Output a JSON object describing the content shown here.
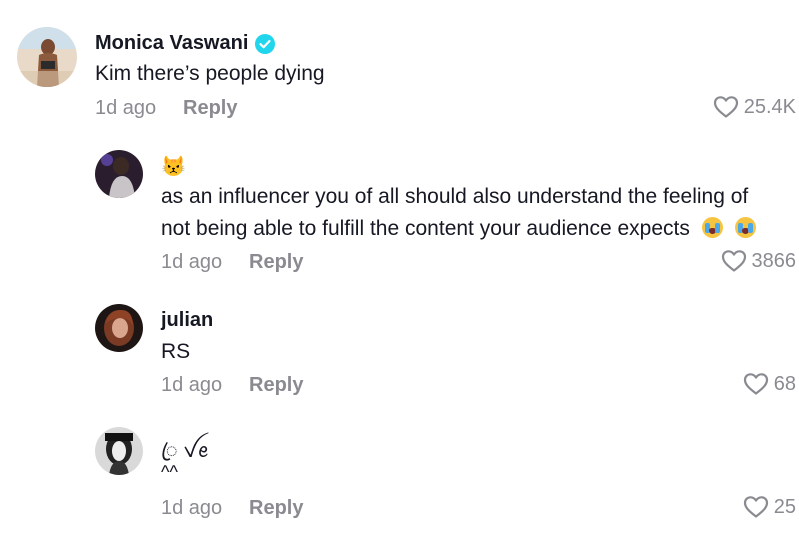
{
  "comments": [
    {
      "username": "Monica Vaswani",
      "verified": true,
      "text": "Kim there’s people dying",
      "time": "1d ago",
      "reply": "Reply",
      "likes": "25.4K"
    },
    {
      "username": "😾",
      "text_line1": "as an influencer you of all should also understand the feeling of",
      "text_line2": "not being able to fulfill the content your audience expects",
      "time": "1d ago",
      "reply": "Reply",
      "likes": "3866"
    },
    {
      "username": "julian",
      "text": "RS",
      "time": "1d ago",
      "reply": "Reply",
      "likes": "68"
    },
    {
      "username": "ꦿ ꪜꫀ",
      "text": "^^",
      "time": "1d ago",
      "reply": "Reply",
      "likes": "25"
    }
  ],
  "colors": {
    "verified": "#20d5ec",
    "muted": "#8a8b91",
    "text": "#161823"
  }
}
